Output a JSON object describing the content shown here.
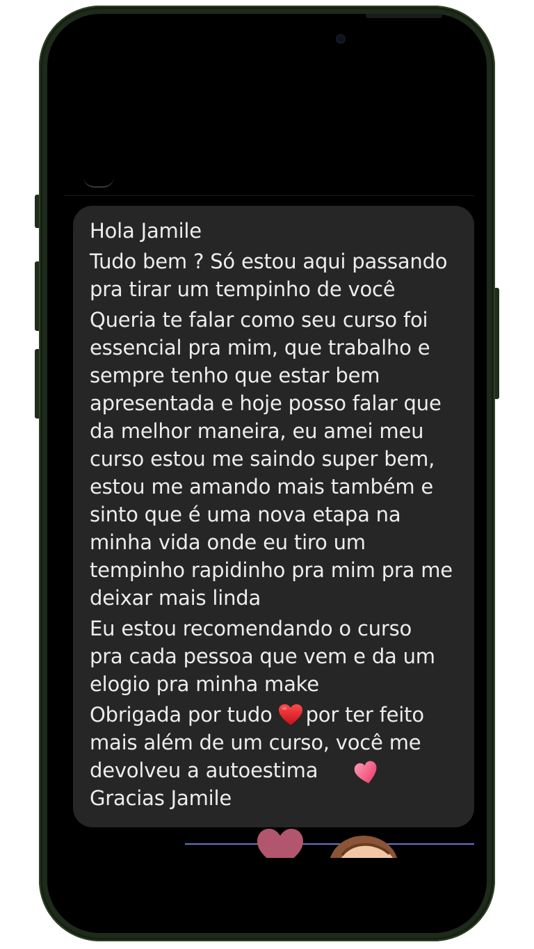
{
  "message": {
    "lines": [
      "Hola Jamile",
      "Tudo bem ? Só estou aqui passando",
      "pra tirar um tempinho de você",
      "Queria te falar como seu curso foi",
      "essencial pra mim, que trabalho e",
      "sempre tenho que estar bem",
      "apresentada e hoje posso falar que",
      "da melhor maneira, eu amei meu",
      "curso estou me saindo super bem,",
      "estou me amando mais também e",
      "sinto que é uma nova etapa na",
      "minha vida onde eu tiro um",
      "tempinho rapidinho pra mim pra me",
      "deixar mais linda",
      "Eu estou recomendando o curso",
      "pra cada pessoa que vem e da um",
      "elogio pra minha make",
      "Obrigada por tudo",
      "por ter feito",
      "mais além de um curso, você me",
      "devolveu a autoestima",
      "Gracias Jamile"
    ],
    "emoji_1": "red-heart-icon",
    "emoji_2": "pink-heart-icon"
  },
  "colors": {
    "bubble": "#262626",
    "text": "#ededed",
    "frame": "#1d2a1c"
  }
}
